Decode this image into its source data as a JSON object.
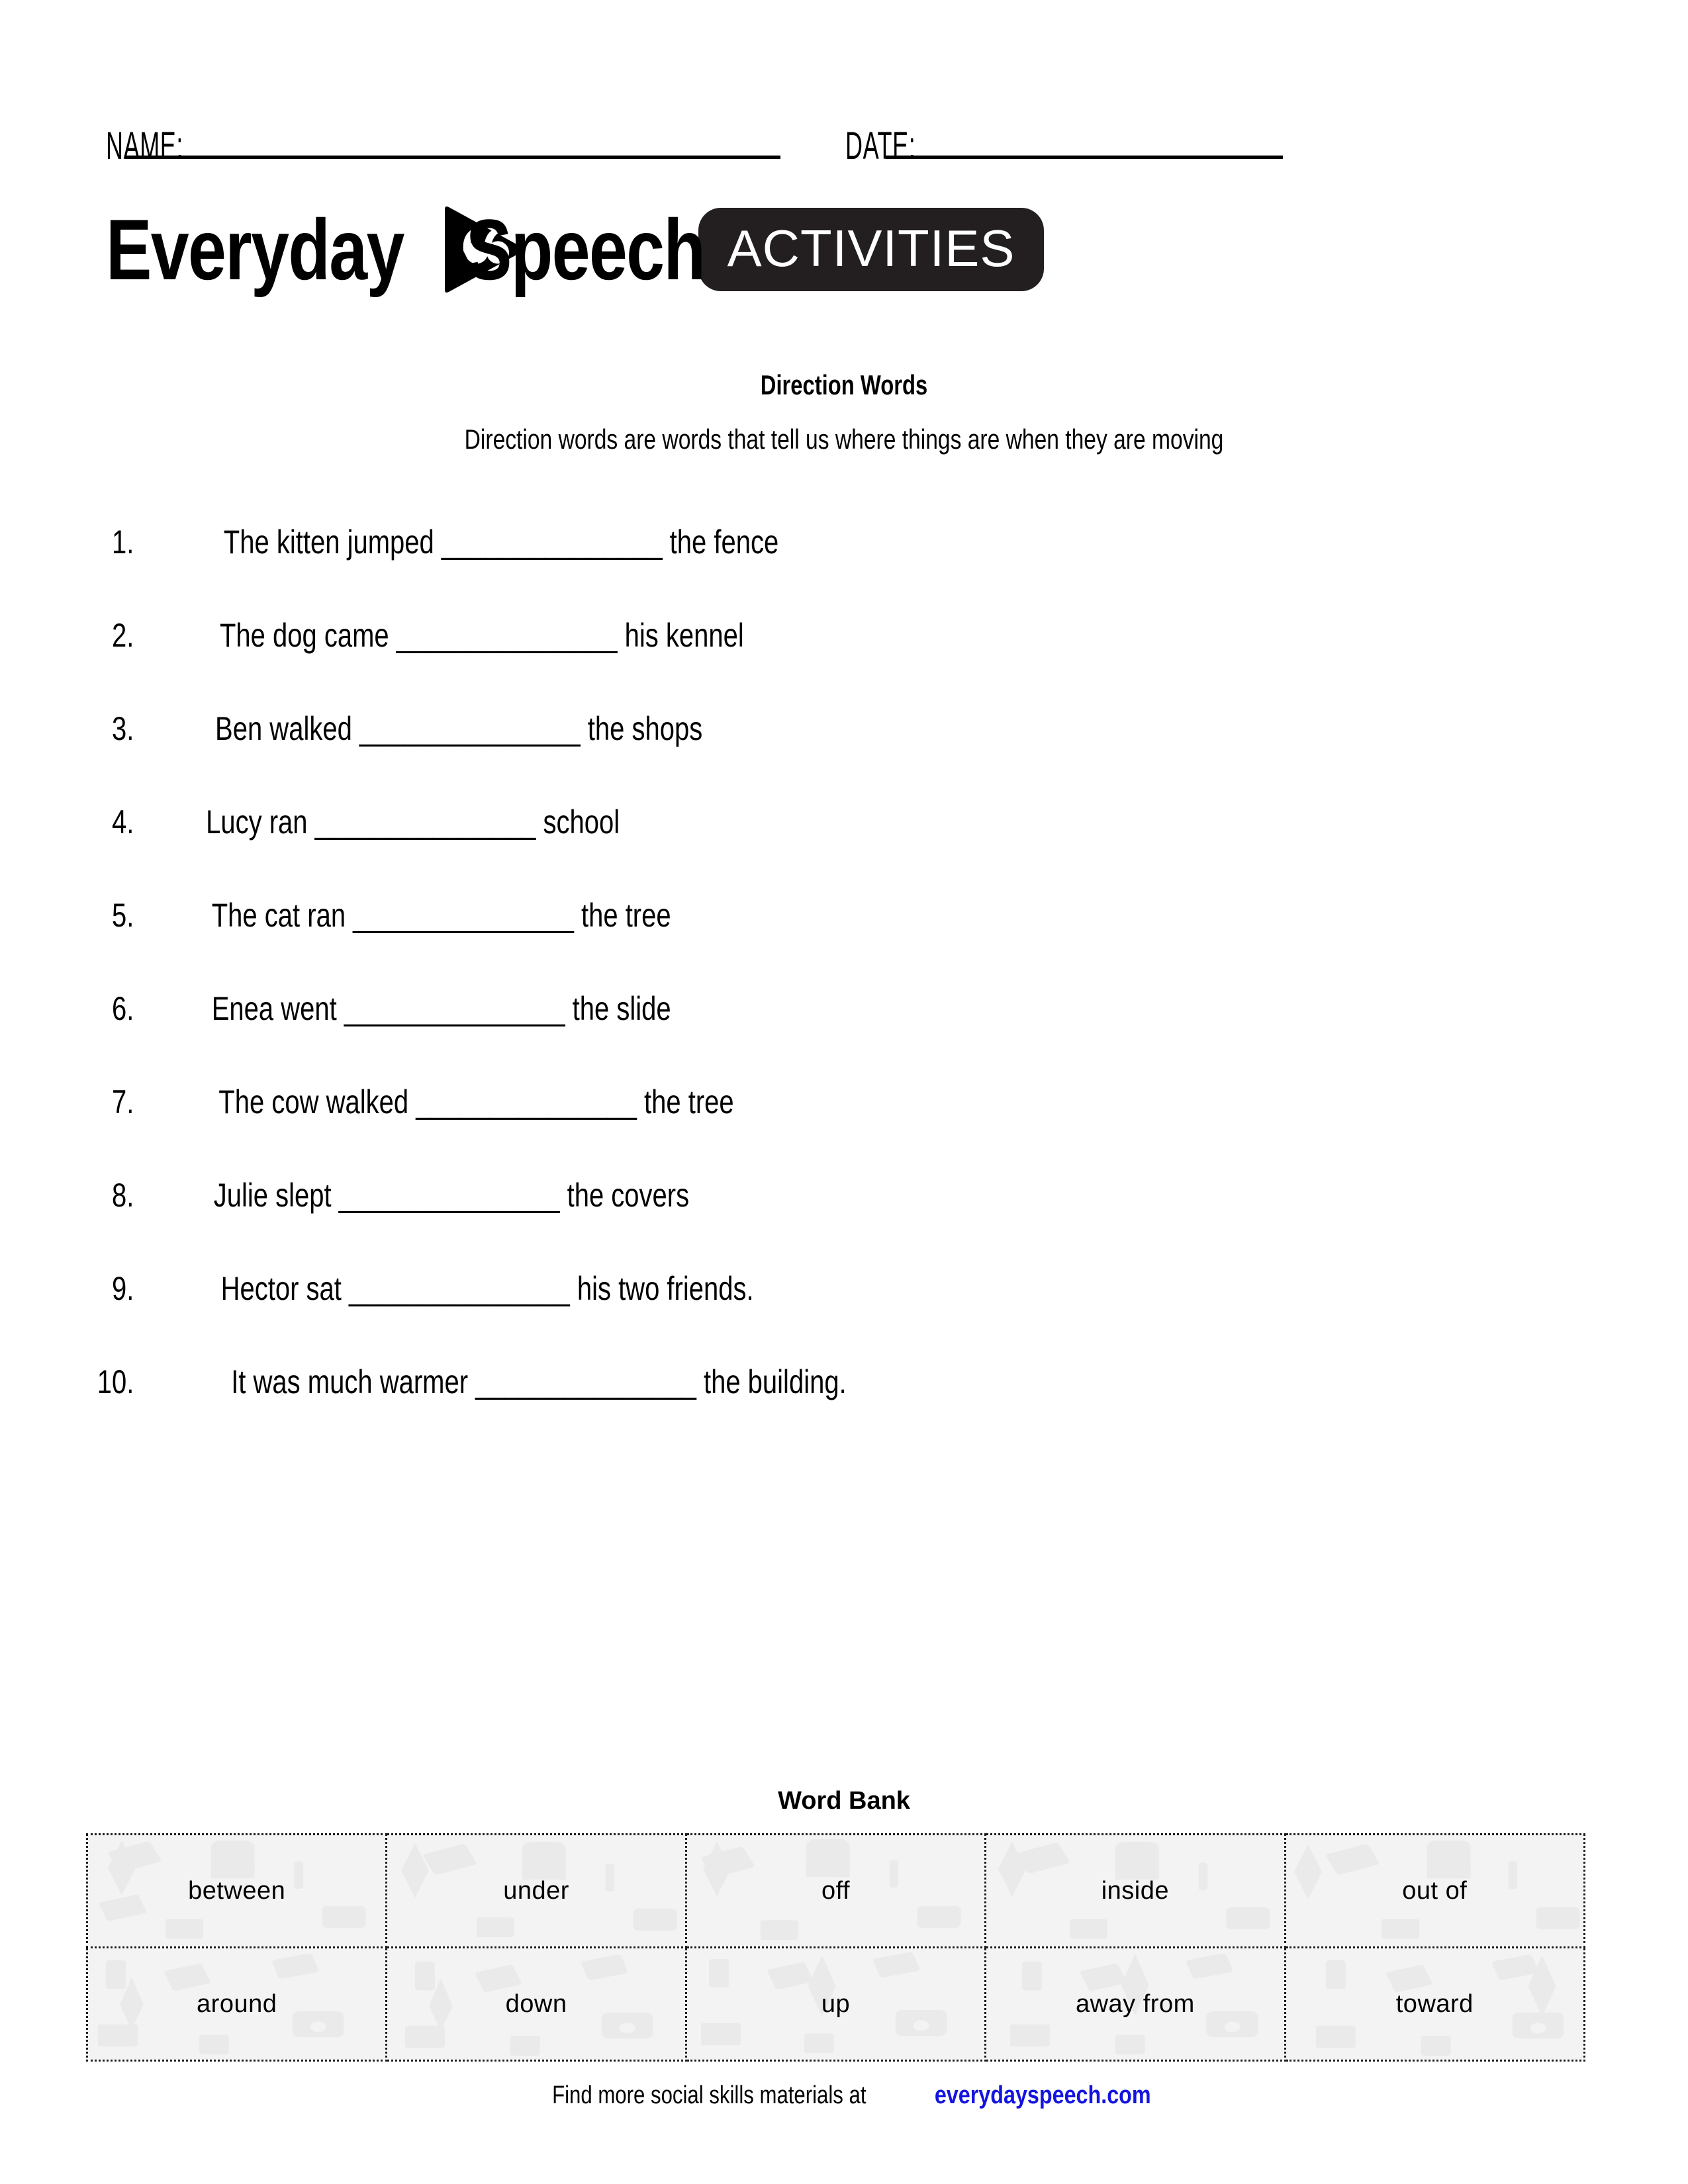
{
  "header": {
    "name_label": "NAME:",
    "date_label": "DATE:"
  },
  "logo": {
    "word_one": "Everyday",
    "word_two": "Speech",
    "mark_name": "play-quote-icon",
    "badge_label": "ACTIVITIES",
    "badge_color": "#231f20"
  },
  "worksheet": {
    "title": "Direction Words",
    "subtitle": "Direction words are words that tell us where things are when they are moving"
  },
  "questions": [
    {
      "num": "1.",
      "text": "The kitten jumped _______________ the fence"
    },
    {
      "num": "2.",
      "text": "The dog came _______________ his kennel"
    },
    {
      "num": "3.",
      "text": "Ben walked _______________ the shops"
    },
    {
      "num": "4.",
      "text": "Lucy ran _______________ school"
    },
    {
      "num": "5.",
      "text": "The cat ran _______________ the tree"
    },
    {
      "num": "6.",
      "text": "Enea went _______________ the slide"
    },
    {
      "num": "7.",
      "text": "The cow walked _______________ the tree"
    },
    {
      "num": "8.",
      "text": "Julie slept _______________ the covers"
    },
    {
      "num": "9.",
      "text": "Hector sat _______________ his two friends."
    },
    {
      "num": "10.",
      "text": "It was much warmer _______________ the building."
    }
  ],
  "word_bank": {
    "heading": "Word Bank",
    "rows": [
      [
        "between",
        "under",
        "off",
        "inside",
        "out of"
      ],
      [
        "around",
        "down",
        "up",
        "away from",
        "toward"
      ]
    ]
  },
  "footer": {
    "text": "Find more social skills materials at",
    "link": "everydayspeech.com",
    "link_color": "#1414e0"
  }
}
